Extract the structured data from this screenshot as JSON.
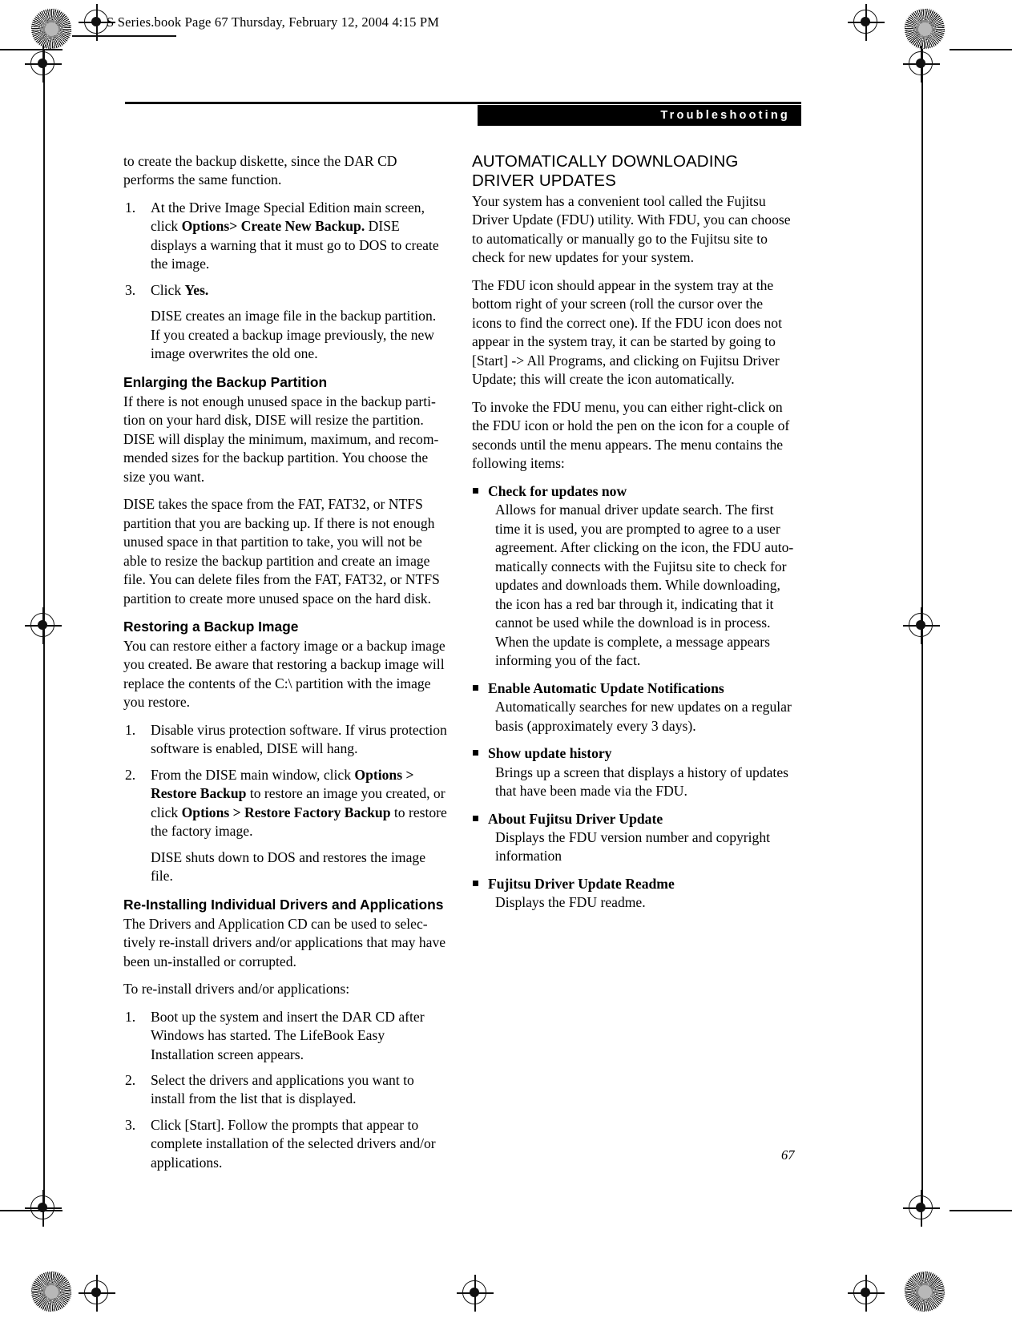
{
  "file_header": "S Series.book  Page 67  Thursday, February 12, 2004  4:15 PM",
  "chapter_banner": "Troubleshooting",
  "page_number": "67",
  "left_column": {
    "intro": "to create the backup diskette, since the DAR CD performs the same function.",
    "backup_steps": [
      {
        "num": "1.",
        "parts": [
          {
            "text": "At the Drive Image Special Edition main screen, click ",
            "bold": false
          },
          {
            "text": "Options> Create New Backup.",
            "bold": true
          },
          {
            "text": " DISE displays a warning that it must go to DOS to create the image.",
            "bold": false
          }
        ]
      },
      {
        "num": "3.",
        "parts": [
          {
            "text": "Click ",
            "bold": false
          },
          {
            "text": "Yes.",
            "bold": true
          }
        ]
      }
    ],
    "backup_steps_note": "DISE creates an image file in the backup partition. If you created a backup image previously, the new image overwrites the old one.",
    "enlarging_heading": "Enlarging the Backup Partition",
    "enlarging_p1": "If there is not enough unused space in the backup parti-tion on your hard disk, DISE will resize the partition. DISE will display the minimum, maximum, and recom-mended sizes for the backup partition. You choose the size you want.",
    "enlarging_p2": "DISE takes the space from the FAT, FAT32, or NTFS partition that you are backing up. If there is not enough unused space in that partition to take, you will not be able to resize the backup partition and create an image file. You can delete files from the FAT, FAT32, or NTFS partition to create more unused space on the hard disk.",
    "restoring_heading": "Restoring a Backup Image",
    "restoring_p1": "You can restore either a factory image or a backup image you created. Be aware that restoring a backup image will replace the contents of the C:\\ partition with the image you restore.",
    "restoring_steps": [
      {
        "num": "1.",
        "parts": [
          {
            "text": "Disable virus protection software. If virus protection software is enabled, DISE will hang.",
            "bold": false
          }
        ]
      },
      {
        "num": "2.",
        "parts": [
          {
            "text": "From the DISE main window, click ",
            "bold": false
          },
          {
            "text": "Options > Restore Backup",
            "bold": true
          },
          {
            "text": " to restore an image you created, or click ",
            "bold": false
          },
          {
            "text": "Options > Restore Factory Backup",
            "bold": true
          },
          {
            "text": " to restore the factory image.",
            "bold": false
          }
        ]
      }
    ],
    "restoring_note": "DISE shuts down to DOS and restores the image file.",
    "reinstalling_heading": "Re-Installing Individual Drivers and Applications",
    "reinstalling_p1": "The Drivers and Application CD can be used to selec-tively re-install drivers and/or applications that may have been un-installed or corrupted.",
    "reinstalling_p2": "To re-install drivers and/or applications:",
    "reinstalling_steps": [
      {
        "num": "1.",
        "parts": [
          {
            "text": "Boot up the system and insert the DAR CD after Windows has started. The LifeBook Easy Installation screen appears.",
            "bold": false
          }
        ]
      },
      {
        "num": "2.",
        "parts": [
          {
            "text": "Select the drivers and applications you want to install from the list that is displayed.",
            "bold": false
          }
        ]
      },
      {
        "num": "3.",
        "parts": [
          {
            "text": "Click [Start]. Follow the prompts that appear to complete installation of the selected drivers and/or applications.",
            "bold": false
          }
        ]
      }
    ]
  },
  "right_column": {
    "heading_line1": "AUTOMATICALLY DOWNLOADING",
    "heading_line2": "DRIVER UPDATES",
    "p1": "Your system has a convenient tool called the Fujitsu Driver Update (FDU) utility. With FDU, you can choose to automatically or manually go to the Fujitsu site to check for new updates for your system.",
    "p2": "The FDU icon should appear in the system tray at the bottom right of your screen (roll the cursor over the icons to find the correct one). If the FDU icon does not appear in the system tray, it can be started by going to [Start] -> All Programs, and clicking on Fujitsu Driver Update; this will create the icon automatically.",
    "p3": "To invoke the FDU menu, you can either right-click on the FDU icon or hold the pen on the icon for a couple of seconds until the menu appears. The menu contains the following items:",
    "menu_items": [
      {
        "title": "Check for updates now",
        "body": "Allows for manual driver update search. The first time it is used, you are prompted to agree to a user agreement. After clicking on the icon, the FDU auto-matically connects with the Fujitsu site to check for updates and downloads them. While downloading, the icon has a red bar through it, indicating that it cannot be used while the download is in process. When the update is complete, a message appears informing you of the fact."
      },
      {
        "title": "Enable Automatic Update Notifications",
        "body": "Automatically searches for new updates on a regular basis (approximately every 3 days)."
      },
      {
        "title": "Show update history",
        "body": "Brings up a screen that displays a history of updates that have been made via the FDU."
      },
      {
        "title": "About Fujitsu Driver Update",
        "body": "Displays the FDU version number and copyright information"
      },
      {
        "title": "Fujitsu Driver Update Readme",
        "body": "Displays the FDU readme."
      }
    ]
  }
}
